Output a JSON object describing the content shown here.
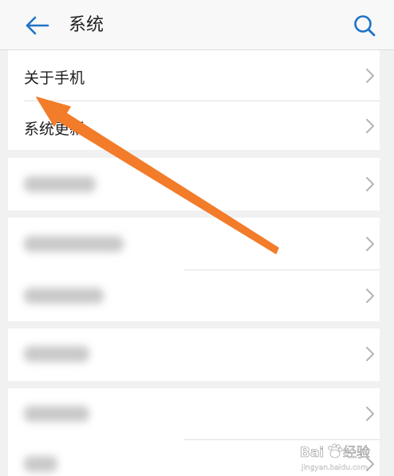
{
  "header": {
    "title": "系统",
    "back_icon": "arrow-left-icon",
    "search_icon": "search-icon"
  },
  "rows": [
    {
      "label": "关于手机"
    },
    {
      "label": "系统更新"
    }
  ],
  "annotation": {
    "color": "#f27c2a"
  },
  "watermark": {
    "brand": "Baidu",
    "cn": "经验",
    "url": "jingyan.baidu.com"
  },
  "colors": {
    "accent": "#1e73c8",
    "background": "#f1f1f1"
  }
}
